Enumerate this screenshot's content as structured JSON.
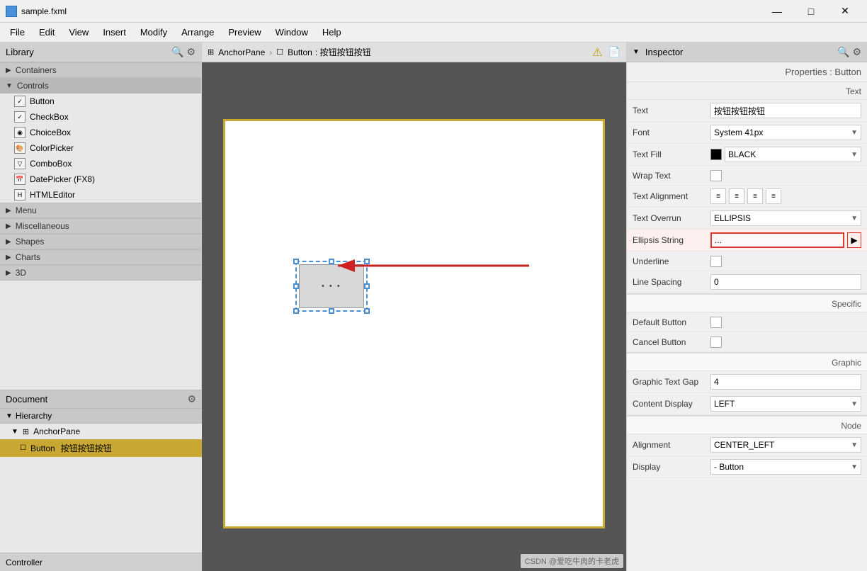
{
  "titleBar": {
    "title": "sample.fxml",
    "iconLabel": "fxml",
    "minimize": "—",
    "maximize": "□",
    "close": "✕"
  },
  "menuBar": {
    "items": [
      "File",
      "Edit",
      "View",
      "Insert",
      "Modify",
      "Arrange",
      "Preview",
      "Window",
      "Help"
    ]
  },
  "library": {
    "header": "Library",
    "searchIcon": "🔍",
    "settingsIcon": "⚙",
    "sections": {
      "containers": "Containers",
      "controls": "Controls",
      "menu": "Menu",
      "miscellaneous": "Miscellaneous",
      "shapes": "Shapes",
      "charts": "Charts",
      "threeDee": "3D"
    },
    "items": [
      "Button",
      "CheckBox",
      "ChoiceBox",
      "ColorPicker",
      "ComboBox",
      "DatePicker (FX8)",
      "HTMLEditor"
    ]
  },
  "document": {
    "header": "Document",
    "settingsIcon": "⚙",
    "hierarchy": "Hierarchy",
    "tree": {
      "anchorPane": "AnchorPane",
      "button": "Button",
      "buttonLabel": "按钮按钮按钮"
    },
    "controller": "Controller"
  },
  "canvas": {
    "breadcrumb": {
      "anchorPane": "AnchorPane",
      "button": "Button",
      "buttonLabel": ": 按钮按钮按钮"
    },
    "warningIcon": "⚠",
    "docIcon": "📄",
    "buttonDots": "• • •"
  },
  "inspector": {
    "header": "Inspector",
    "searchIcon": "🔍",
    "settingsIcon": "⚙",
    "subtitle": "Properties : Button",
    "sections": {
      "text": "Text",
      "specific": "Specific",
      "graphic": "Graphic",
      "node": "Node"
    },
    "properties": {
      "text": {
        "label": "Text",
        "value": "按钮按钮按钮"
      },
      "font": {
        "label": "Font",
        "value": "System 41px"
      },
      "textFill": {
        "label": "Text Fill",
        "value": "BLACK"
      },
      "wrapText": {
        "label": "Wrap Text"
      },
      "textAlignment": {
        "label": "Text Alignment"
      },
      "textOverrun": {
        "label": "Text Overrun",
        "value": "ELLIPSIS"
      },
      "ellipsisString": {
        "label": "Ellipsis String",
        "value": "..."
      },
      "underline": {
        "label": "Underline"
      },
      "lineSpacing": {
        "label": "Line Spacing",
        "value": "0"
      },
      "defaultButton": {
        "label": "Default Button"
      },
      "cancelButton": {
        "label": "Cancel Button"
      },
      "graphicTextGap": {
        "label": "Graphic Text Gap",
        "value": "4"
      },
      "contentDisplay": {
        "label": "Content Display",
        "value": "LEFT"
      },
      "alignment": {
        "label": "Alignment",
        "value": "CENTER_LEFT"
      }
    }
  }
}
